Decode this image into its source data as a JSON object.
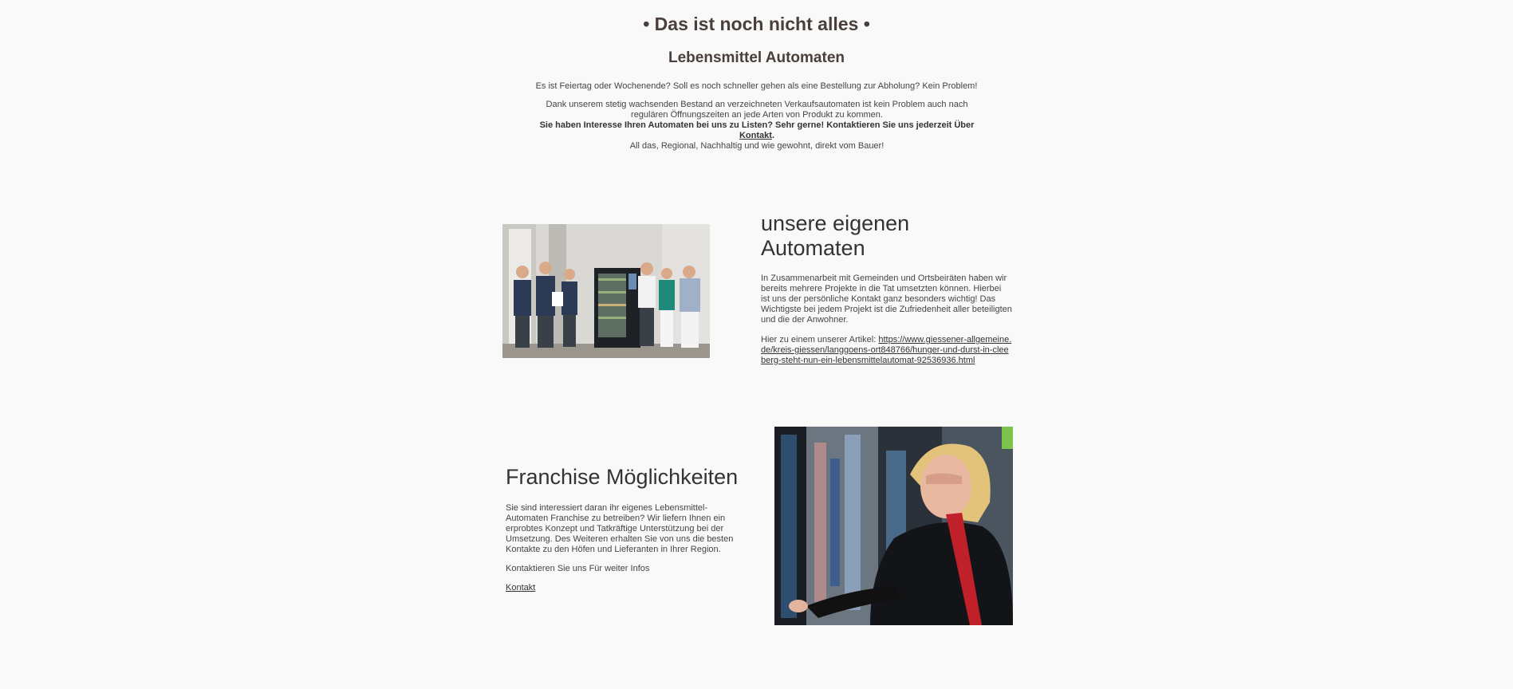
{
  "intro": {
    "title": "• Das ist noch nicht alles •",
    "subtitle": "Lebensmittel Automaten",
    "paragraph1": "Es ist Feiertag oder Wochenende? Soll es noch schneller gehen als eine Bestellung zur Abholung? Kein Problem!",
    "paragraph2": "Dank unserem stetig wachsenden Bestand an verzeichneten Verkaufsautomaten ist kein Problem auch nach regulären Öffnungszeiten an jede Arten von Produkt zu kommen.",
    "bold_text": "Sie haben Interesse Ihren Automaten bei uns zu Listen? Sehr gerne! Kontaktieren Sie uns jederzeit Über",
    "bold_link": "Kontakt",
    "bold_end": ".",
    "closing": "All das, Regional, Nachhaltig und wie gewohnt, direkt vom Bauer!"
  },
  "section_own": {
    "heading": "unsere eigenen Automaten",
    "text": "In Zusammenarbeit mit Gemeinden und Ortsbeiräten haben wir bereits mehrere Projekte in die Tat umsetzten können. Hierbei ist uns der persönliche Kontakt ganz besonders wichtig! Das Wichtigste bei jedem Projekt ist die Zufriedenheit aller beteiligten und die der Anwohner.",
    "article_prefix": "Hier zu einem unserer Artikel:",
    "article_link": "https://www.giessener-allgemeine.de/kreis-giessen/langgoens-ort848766/hunger-und-durst-in-cleeberg-steht-nun-ein-lebensmittelautomat-92536936.html"
  },
  "section_franchise": {
    "heading": "Franchise Möglichkeiten",
    "text": "Sie sind interessiert daran ihr eigenes Lebensmittel-Automaten Franchise zu betreiben? Wir liefern Ihnen ein erprobtes Konzept und Tatkräftige Unterstützung bei der Umsetzung. Des Weiteren erhalten Sie von uns die besten Kontakte zu den Höfen und Lieferanten in Ihrer Region.",
    "contact_text": "Kontaktieren Sie uns Für weiter Infos",
    "contact_link": "Kontakt"
  },
  "colors": {
    "background": "#f9f9f9",
    "heading": "#4a3f3a",
    "text": "#444444"
  }
}
